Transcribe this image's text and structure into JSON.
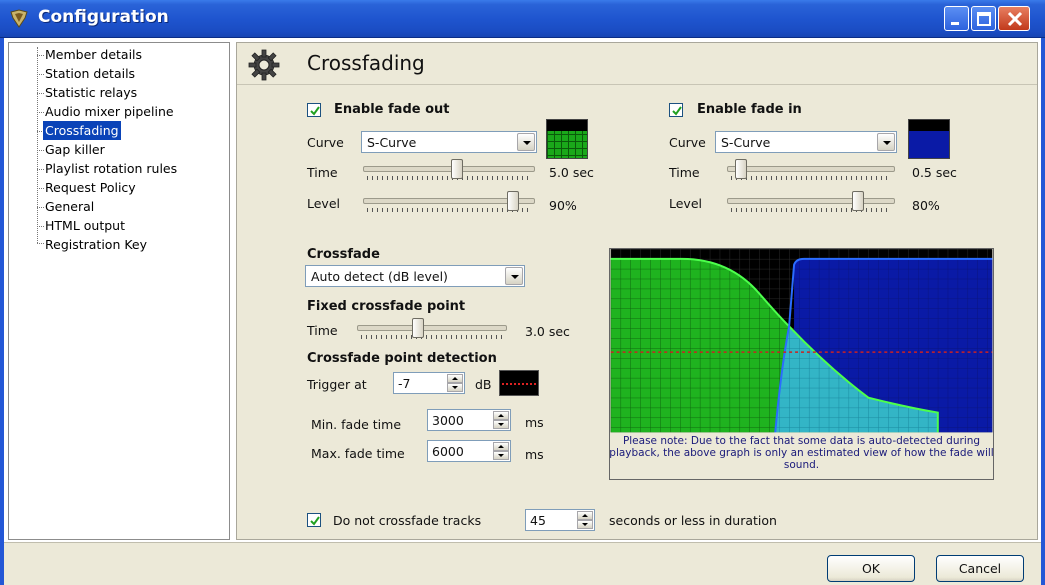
{
  "window": {
    "title": "Configuration"
  },
  "sidebar": {
    "items": [
      {
        "label": "Member details"
      },
      {
        "label": "Station details"
      },
      {
        "label": "Statistic relays"
      },
      {
        "label": "Audio mixer pipeline"
      },
      {
        "label": "Crossfading",
        "selected": true
      },
      {
        "label": "Gap killer"
      },
      {
        "label": "Playlist rotation rules"
      },
      {
        "label": "Request Policy"
      },
      {
        "label": "General"
      },
      {
        "label": "HTML output"
      },
      {
        "label": "Registration Key"
      }
    ]
  },
  "main": {
    "title": "Crossfading",
    "fade_out": {
      "label": "Enable fade out",
      "checked": true,
      "curve_label": "Curve",
      "curve_value": "S-Curve",
      "time_label": "Time",
      "time_value": "5.0 sec",
      "time_level": 0.55,
      "level_label": "Level",
      "level_value": "90%",
      "level_level": 0.9,
      "swatch_color": "#1aa81a"
    },
    "fade_in": {
      "label": "Enable fade in",
      "checked": true,
      "curve_label": "Curve",
      "curve_value": "S-Curve",
      "time_label": "Time",
      "time_value": "0.5 sec",
      "time_level": 0.05,
      "level_label": "Level",
      "level_value": "80%",
      "level_level": 0.8,
      "swatch_color": "#0a1aa6"
    },
    "crossfade": {
      "heading": "Crossfade",
      "mode_value": "Auto detect (dB level)",
      "fixed_heading": "Fixed crossfade point",
      "fixed_time_label": "Time",
      "fixed_time_value": "3.0 sec",
      "fixed_time_level": 0.4,
      "detection_heading": "Crossfade point detection",
      "trigger_label": "Trigger at",
      "trigger_value": "-7",
      "trigger_unit": "dB",
      "min_fade_label": "Min. fade time",
      "min_fade_value": "3000",
      "min_fade_unit": "ms",
      "max_fade_label": "Max. fade time",
      "max_fade_value": "6000",
      "max_fade_unit": "ms"
    },
    "graph_note": "Please note: Due to the fact that some data is auto-detected during playback, the above graph is only an estimated view of how the fade will sound.",
    "no_crossfade": {
      "checked": true,
      "prefix": "Do not crossfade tracks",
      "value": "45",
      "suffix": "seconds or less in duration"
    }
  },
  "buttons": {
    "ok": "OK",
    "cancel": "Cancel"
  },
  "colors": {
    "titlebar": "#1f55cf",
    "selection": "#0a43b8",
    "panel": "#ece9d8",
    "graph_green": "#1fb31f",
    "graph_blue": "#0a1aa6",
    "graph_overlap": "#33b5c6",
    "trigger_line": "#cc2222"
  }
}
